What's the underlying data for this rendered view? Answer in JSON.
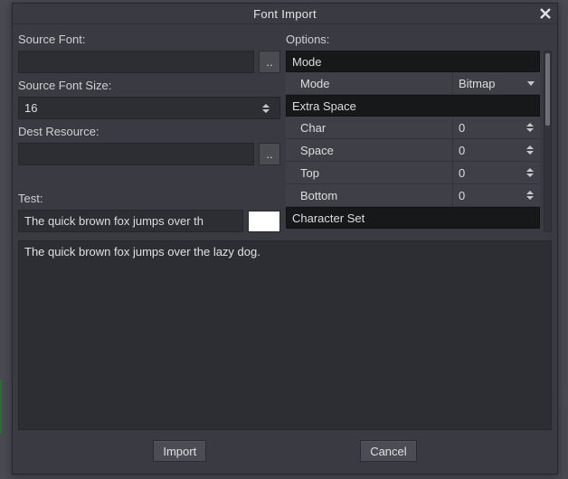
{
  "dialog": {
    "title": "Font Import"
  },
  "left": {
    "sourceFontLabel": "Source Font:",
    "sourceFontValue": "",
    "browse1": "..",
    "sourceSizeLabel": "Source Font Size:",
    "sourceSizeValue": "16",
    "destLabel": "Dest Resource:",
    "destValue": "",
    "browse2": "..",
    "testLabel": "Test:",
    "testValue": "The quick brown fox jumps over th",
    "swatchColor": "#ffffff",
    "previewText": "The quick brown fox jumps over the lazy dog."
  },
  "right": {
    "optionsLabel": "Options:",
    "groups": {
      "modeHeader": "Mode",
      "modeItem": "Mode",
      "modeValue": "Bitmap",
      "extraHeader": "Extra Space",
      "char": "Char",
      "charVal": "0",
      "space": "Space",
      "spaceVal": "0",
      "top": "Top",
      "topVal": "0",
      "bottom": "Bottom",
      "bottomVal": "0",
      "charsetHeader": "Character Set"
    }
  },
  "footer": {
    "import": "Import",
    "cancel": "Cancel"
  }
}
